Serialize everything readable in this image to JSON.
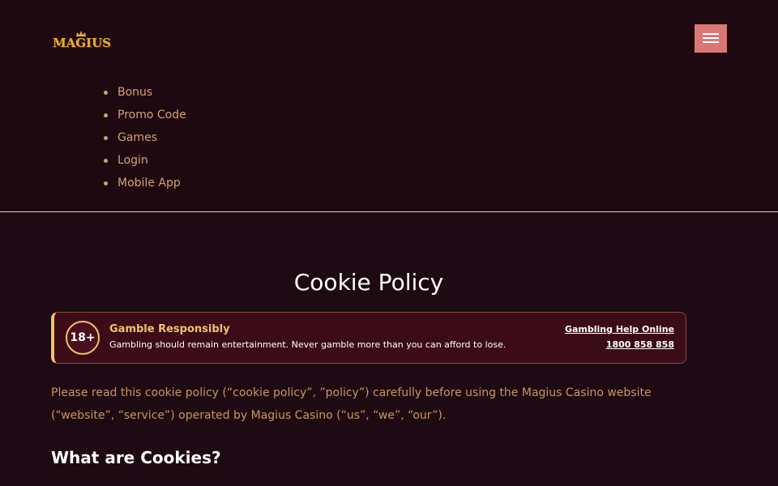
{
  "header": {
    "logo_text": "MAGIUS",
    "menu_label": "",
    "nav": [
      {
        "label": "Bonus"
      },
      {
        "label": "Promo Code"
      },
      {
        "label": "Games"
      },
      {
        "label": "Login"
      },
      {
        "label": "Mobile App"
      }
    ]
  },
  "main": {
    "title": "Cookie Policy",
    "notice": {
      "badge": "18+",
      "title": "Gamble Responsibly",
      "text": "Gambling should remain entertainment. Never gamble more than you can afford to lose.",
      "help_link": "Gambling Help Online",
      "phone": "1800 858 858"
    },
    "intro": "Please read this cookie policy (“cookie policy”, ”policy”) carefully before using the Magius Casino website (“website”, “service”) operated by Magius Casino (“us”, “we”, “our”).",
    "section_heading": "What are Cookies?"
  },
  "colors": {
    "background": "#1e0a12",
    "accent": "#d97777",
    "gold": "#f0c26a",
    "link_tan": "#d2a373"
  },
  "icons": {
    "menu": "hamburger-icon",
    "bullet": "bullet-dot-icon"
  }
}
